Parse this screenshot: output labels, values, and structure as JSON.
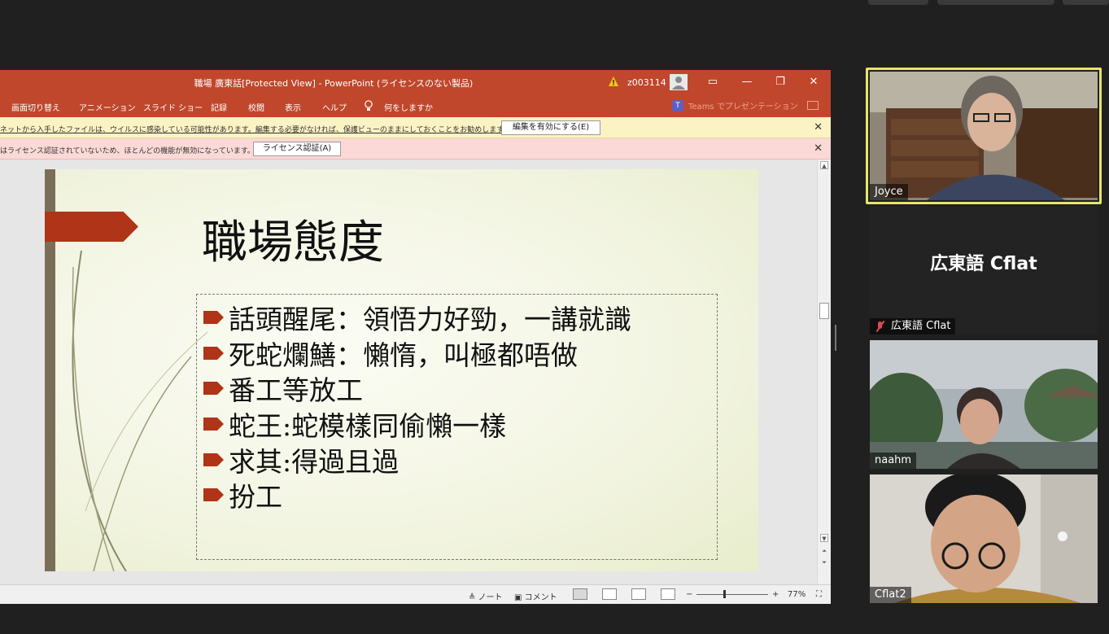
{
  "powerpoint": {
    "title": "職場 廣東話[Protected View]  -  PowerPoint (ライセンスのない製品)",
    "user": "z003114",
    "ribbon_tabs": [
      "画面切り替え",
      "アニメーション",
      "スライド ショー",
      "記録",
      "校閲",
      "表示",
      "ヘルプ"
    ],
    "tell_me": "何をしますか",
    "teams_label": "Teams でプレゼンテーション",
    "protected_bar": {
      "message": "ネットから入手したファイルは、ウイルスに感染している可能性があります。編集する必要がなければ、保護ビューのままにしておくことをお勧めします。",
      "button": "編集を有効にする(E)"
    },
    "license_bar": {
      "message": "はライセンス認証されていないため、ほとんどの機能が無効になっています。",
      "button": "ライセンス認証(A)"
    },
    "slide": {
      "title": "職場態度",
      "bullets": [
        "話頭醒尾：領悟力好勁，一講就識",
        "死蛇爛鱔：懶惰，叫極都唔做",
        "番工等放工",
        "蛇王:蛇模樣同偷懶一樣",
        "求其:得過且過",
        "扮工"
      ]
    },
    "status": {
      "notes": "ノート",
      "comments": "コメント",
      "zoom": "77%",
      "zoom_minus": "−",
      "zoom_plus": "+"
    }
  },
  "participants": [
    {
      "name": "Joyce",
      "active": true
    },
    {
      "name": "広東語 Cflat",
      "display_name": "広東語 Cflat",
      "muted": true
    },
    {
      "name": "naahm"
    },
    {
      "name": "Cflat2"
    }
  ],
  "colors": {
    "ppt_red": "#c0472c",
    "bullet_red": "#b03417",
    "active_speaker": "#e8e46a"
  }
}
